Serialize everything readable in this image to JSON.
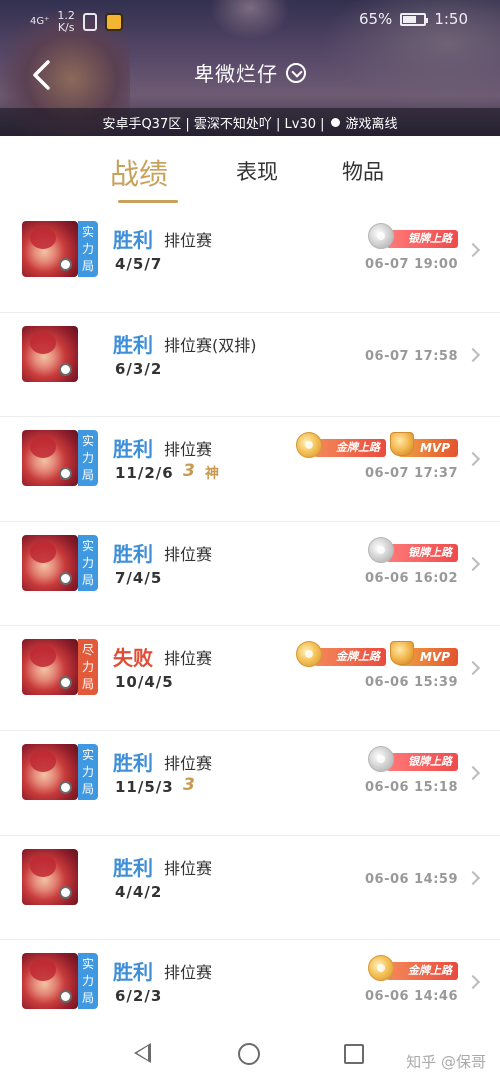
{
  "status_bar": {
    "network": "4G⁺",
    "speed": "1.2",
    "speed_unit": "K/s",
    "battery_level_percent": 65,
    "battery": "65%",
    "time": "1:50"
  },
  "header": {
    "title": "卑微烂仔",
    "info": "安卓手Q37区 | 雲深不知处吖 | Lv30 |",
    "status": "游戏离线"
  },
  "tabs": [
    {
      "label": "战绩",
      "active": true
    },
    {
      "label": "表现",
      "active": false
    },
    {
      "label": "物品",
      "active": false
    }
  ],
  "matches": [
    {
      "mode": "实力局",
      "mode_color": "#3f98e0",
      "result": "胜利",
      "win": true,
      "type": "排位赛",
      "kda": "4/5/7",
      "multi_kill": "",
      "godlike": "",
      "badges": [
        "银牌上路"
      ],
      "time": "06-07 19:00"
    },
    {
      "mode": "",
      "mode_color": "",
      "result": "胜利",
      "win": true,
      "type": "排位赛(双排)",
      "kda": "6/3/2",
      "multi_kill": "",
      "godlike": "",
      "badges": [],
      "time": "06-07 17:58"
    },
    {
      "mode": "实力局",
      "mode_color": "#3f98e0",
      "result": "胜利",
      "win": true,
      "type": "排位赛",
      "kda": "11/2/6",
      "multi_kill": "3",
      "godlike": "神",
      "badges": [
        "金牌上路",
        "MVP"
      ],
      "time": "06-07 17:37"
    },
    {
      "mode": "实力局",
      "mode_color": "#3f98e0",
      "result": "胜利",
      "win": true,
      "type": "排位赛",
      "kda": "7/4/5",
      "multi_kill": "",
      "godlike": "",
      "badges": [
        "银牌上路"
      ],
      "time": "06-06 16:02"
    },
    {
      "mode": "尽力局",
      "mode_color": "#e25a3a",
      "result": "失败",
      "win": false,
      "type": "排位赛",
      "kda": "10/4/5",
      "multi_kill": "",
      "godlike": "",
      "badges": [
        "金牌上路",
        "MVP"
      ],
      "time": "06-06 15:39"
    },
    {
      "mode": "实力局",
      "mode_color": "#3f98e0",
      "result": "胜利",
      "win": true,
      "type": "排位赛",
      "kda": "11/5/3",
      "multi_kill": "3",
      "godlike": "",
      "badges": [
        "银牌上路"
      ],
      "time": "06-06 15:18"
    },
    {
      "mode": "",
      "mode_color": "",
      "result": "胜利",
      "win": true,
      "type": "排位赛",
      "kda": "4/4/2",
      "multi_kill": "",
      "godlike": "",
      "badges": [],
      "time": "06-06 14:59"
    },
    {
      "mode": "实力局",
      "mode_color": "#3f98e0",
      "result": "胜利",
      "win": true,
      "type": "排位赛",
      "kda": "6/2/3",
      "multi_kill": "",
      "godlike": "",
      "badges": [
        "金牌上路"
      ],
      "time": "06-06 14:46"
    }
  ],
  "watermark": "知乎 @保哥",
  "colors": {
    "win": "#3f8fd8",
    "lose": "#e24c36",
    "accent_gold": "#c8a15a"
  }
}
